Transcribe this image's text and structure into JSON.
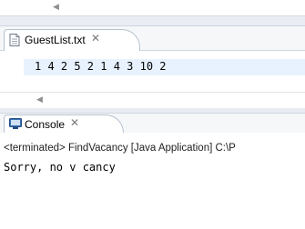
{
  "editor": {
    "tab_title": "GuestList.txt",
    "close_glyph": "✕",
    "content": "1 4 2 5 2 1 4 3 10 2",
    "arrow": "◀"
  },
  "console": {
    "tab_title": "Console",
    "close_glyph": "✕",
    "status": "<terminated> FindVacancy [Java Application] C:\\P",
    "output": "Sorry, no v cancy"
  },
  "top": {
    "arrow": "◀"
  },
  "colors": {
    "line_highlight": "#e8f2fe",
    "console_icon": "#3a6fb3",
    "file_icon_fold": "#e4e4e4"
  }
}
